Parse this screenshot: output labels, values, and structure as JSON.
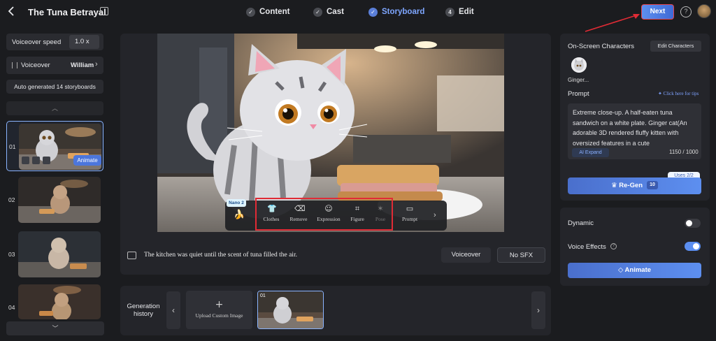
{
  "header": {
    "title": "The Tuna Betrayal",
    "steps": [
      {
        "label": "Content",
        "marker": "✓"
      },
      {
        "label": "Cast",
        "marker": "✓"
      },
      {
        "label": "Storyboard",
        "marker": "✓"
      },
      {
        "label": "Edit",
        "marker": "4"
      }
    ],
    "next_label": "Next",
    "help_glyph": "?"
  },
  "sidebar": {
    "voiceover_speed_label": "Voiceover speed",
    "voiceover_speed_value": "1.0 x",
    "voiceover_label": "Voiceover",
    "voiceover_name": "William",
    "auto_generated": "Auto generated 14 storyboards",
    "storyboards": [
      {
        "num": "01",
        "animate_label": "Animate"
      },
      {
        "num": "02"
      },
      {
        "num": "03"
      },
      {
        "num": "04"
      }
    ]
  },
  "editor": {
    "nano_badge": "Nano 2",
    "tools": [
      {
        "label": "Clothes",
        "icon": "shirt-icon"
      },
      {
        "label": "Remove",
        "icon": "eraser-icon"
      },
      {
        "label": "Expression",
        "icon": "smile-icon"
      },
      {
        "label": "Figure",
        "icon": "figure-icon"
      },
      {
        "label": "Pose",
        "icon": "pose-icon"
      },
      {
        "label": "Prompt",
        "icon": "prompt-icon"
      }
    ],
    "caption": "The kitchen was quiet until the scent of tuna filled the air.",
    "voiceover_btn": "Voiceover",
    "nosfx_btn": "No SFX"
  },
  "generation": {
    "label": "Generation history",
    "upload_label": "Upload Custom Image",
    "thumb_num": "01"
  },
  "right": {
    "onscreen_title": "On-Screen Characters",
    "edit_characters": "Edit Characters",
    "character_name": "Ginger...",
    "prompt_label": "Prompt",
    "tips": "Click here for tips",
    "prompt_text": "Extreme close-up. A half-eaten tuna sandwich on a white plate. Ginger cat(An adorable 3D rendered fluffy kitten with oversized features in a cute",
    "ai_expand": "AI Expand",
    "char_count": "1150 / 1000",
    "uses": "Uses  2/2",
    "regen_label": "Re-Gen",
    "regen_cost": "10",
    "dynamic_label": "Dynamic",
    "dynamic_on": false,
    "voice_effects_label": "Voice Effects",
    "voice_effects_on": true,
    "animate_label": "Animate"
  },
  "colors": {
    "accent": "#5b8ef0",
    "highlight_red": "#e02b35",
    "background": "#1b1c1f",
    "panel": "#24252a"
  }
}
